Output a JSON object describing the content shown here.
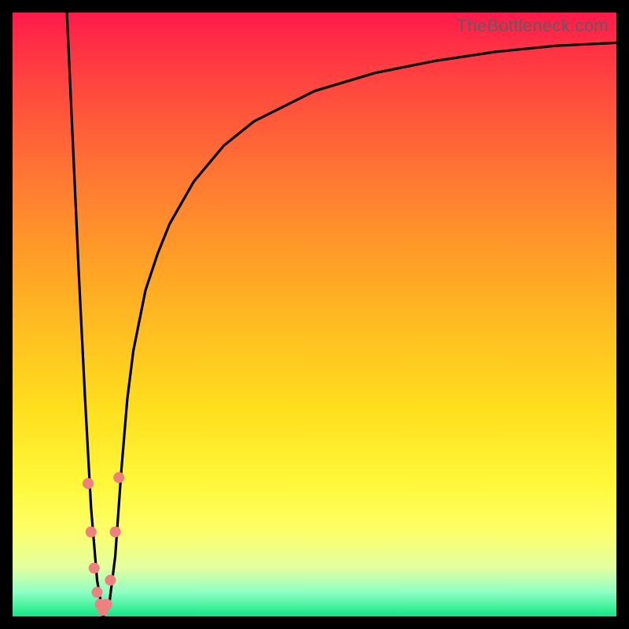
{
  "watermark": "TheBottleneck.com",
  "chart_data": {
    "type": "line",
    "title": "",
    "xlabel": "",
    "ylabel": "",
    "xlim": [
      0,
      100
    ],
    "ylim": [
      0,
      100
    ],
    "series": [
      {
        "name": "bottleneck-curve",
        "x": [
          9,
          10,
          11,
          12,
          13,
          14,
          15,
          16,
          17,
          18,
          19,
          20,
          22,
          24,
          26,
          30,
          35,
          40,
          50,
          60,
          70,
          80,
          90,
          100
        ],
        "y": [
          100,
          78,
          56,
          36,
          18,
          6,
          0,
          2,
          10,
          24,
          36,
          44,
          54,
          60,
          65,
          72,
          78,
          82,
          87,
          90,
          92,
          93.5,
          94.5,
          95
        ]
      }
    ],
    "markers": {
      "name": "highlight-dots",
      "x": [
        12.5,
        13.0,
        13.5,
        14.0,
        14.5,
        15.0,
        15.6,
        16.2,
        17.0,
        17.6
      ],
      "y": [
        22,
        14,
        8,
        4,
        2,
        1,
        2,
        6,
        14,
        23
      ]
    },
    "colors": {
      "curve": "#000000",
      "markers": "#f08080",
      "gradient_top": "#ff1a4b",
      "gradient_bottom": "#10e884"
    }
  }
}
